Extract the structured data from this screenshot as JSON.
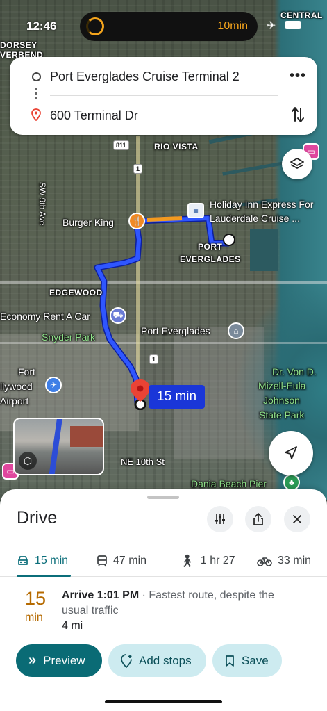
{
  "status_bar": {
    "time": "12:46",
    "live_activity_time": "10min"
  },
  "route_card": {
    "origin": "Port Everglades Cruise Terminal 2",
    "destination": "600 Terminal Dr"
  },
  "map": {
    "labels": {
      "dorsey_riverbend": "DORSEY\nVERBEND",
      "central": "CENTRAL",
      "rio_vista": "RIO VISTA",
      "sw9th": "SW 9th Ave",
      "burger_king": "Burger King",
      "holiday_inn_1": "Holiday Inn Express For",
      "holiday_inn_2": "Lauderdale Cruise ...",
      "port_everglades_area_1": "PORT",
      "port_everglades_area_2": "EVERGLADES",
      "edgewood": "EDGEWOOD",
      "economy_rent": "Economy Rent A Car",
      "snyder_park": "Snyder Park",
      "port_everglades": "Port Everglades",
      "fort_1": "Fort",
      "fort_2": "llywood",
      "fort_3": "Airport",
      "mizell_1": "Dr. Von D.",
      "mizell_2": "Mizell-Eula",
      "mizell_3": "Johnson",
      "mizell_4": "State Park",
      "ne10th": "NE 10th St",
      "dania_pier": "Dania Beach Pier",
      "shield_811": "811",
      "shield_1a": "1",
      "shield_1b": "1"
    },
    "eta_badge": "15 min"
  },
  "sheet": {
    "title": "Drive",
    "modes": [
      {
        "label": "15 min",
        "icon": "car-icon",
        "active": true
      },
      {
        "label": "47 min",
        "icon": "transit-icon",
        "active": false
      },
      {
        "label": "1 hr 27",
        "icon": "walk-icon",
        "active": false
      },
      {
        "label": "33 min",
        "icon": "bike-icon",
        "active": false
      }
    ],
    "result": {
      "duration_number": "15",
      "duration_unit": "min",
      "arrive": "Arrive 1:01 PM",
      "arrive_detail": " · Fastest route, despite the usual traffic",
      "distance": "4 mi"
    },
    "actions": {
      "preview": "Preview",
      "add_stops": "Add stops",
      "save": "Save"
    }
  },
  "colors": {
    "route": "#1a36d8",
    "accent": "#0a6b75",
    "duration": "#b56a00"
  }
}
